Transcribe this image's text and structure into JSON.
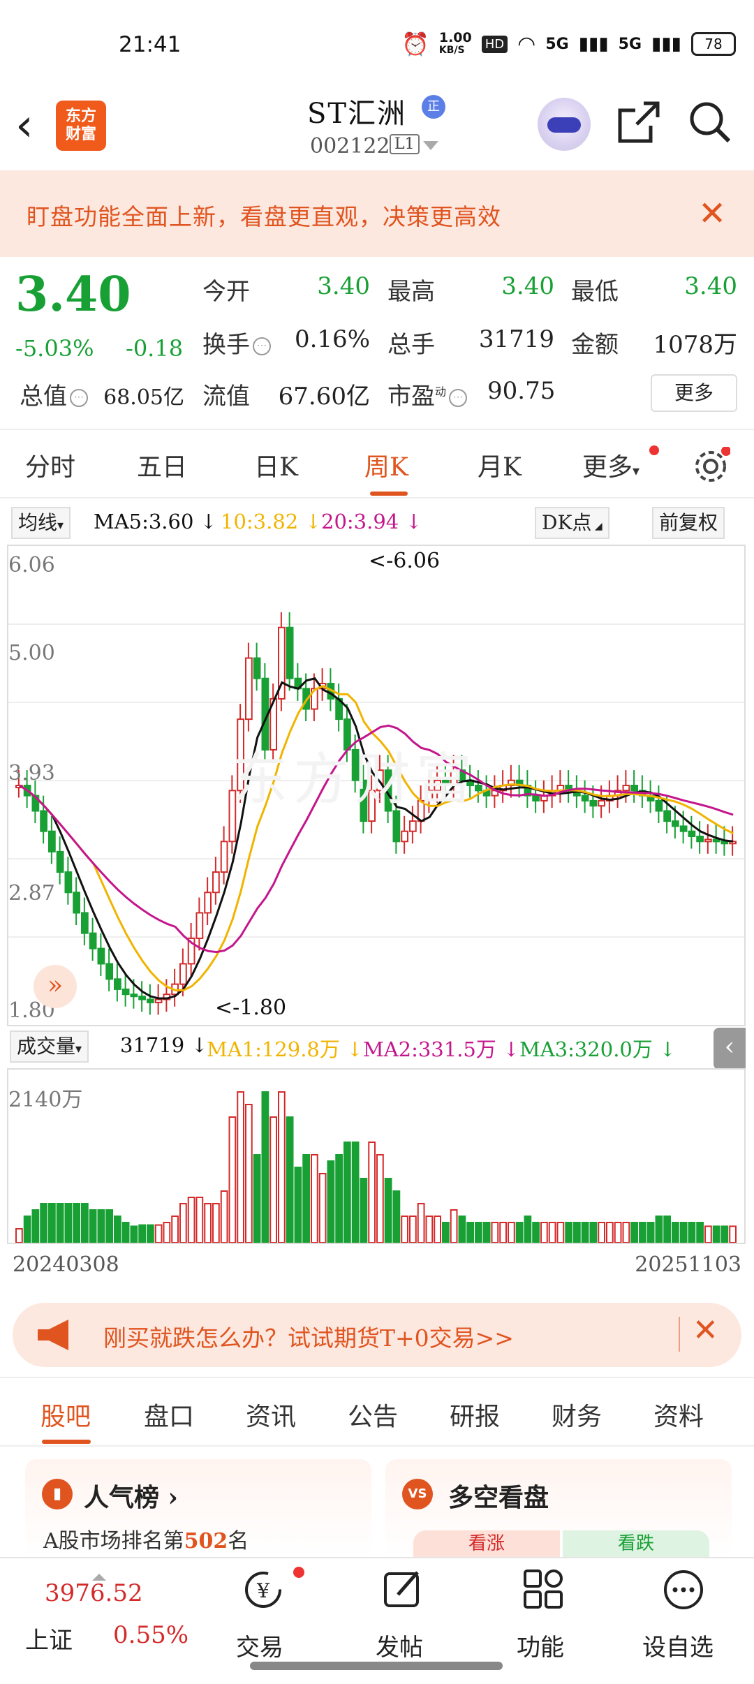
{
  "status_bar": {
    "time": "21:41",
    "net_speed_top": "1.00",
    "net_speed_unit": "KB/S",
    "hd": "HD",
    "sig1": "5G",
    "sig2": "5G",
    "battery": "78"
  },
  "header": {
    "logo_line1": "东方",
    "logo_line2": "财富",
    "title": "ST汇洲",
    "title_badge": "正",
    "code": "002122",
    "level": "L1"
  },
  "notice": {
    "text": "盯盘功能全面上新，看盘更直观，决策更高效"
  },
  "quote": {
    "price": "3.40",
    "change_pct": "-5.03%",
    "change_amt": "-0.18",
    "open_label": "今开",
    "open": "3.40",
    "high_label": "最高",
    "high": "3.40",
    "low_label": "最低",
    "low": "3.40",
    "turnover_label": "换手",
    "turnover": "0.16%",
    "volume_label": "总手",
    "volume": "31719",
    "amount_label": "金额",
    "amount": "1078万",
    "mktcap_label": "总值",
    "mktcap": "68.05亿",
    "float_label": "流值",
    "float": "67.60亿",
    "pe_label": "市盈",
    "pe_sup": "动",
    "pe": "90.75",
    "more": "更多"
  },
  "tabs": [
    "分时",
    "五日",
    "日K",
    "周K",
    "月K",
    "更多"
  ],
  "active_tab": "周K",
  "chart_toolbar": {
    "ma_label": "均线",
    "ma5": "MA5:3.60",
    "ma10": "10:3.82",
    "ma20": "20:3.94",
    "dk": "DK点",
    "adjust": "前复权"
  },
  "kline": {
    "y_ticks": [
      "6.06",
      "5.00",
      "3.93",
      "2.87",
      "1.80"
    ],
    "max_label": "<-6.06",
    "min_label": "<-1.80",
    "watermark": "东方财富"
  },
  "volume_bar": {
    "label": "成交量",
    "vol": "31719",
    "ma1": "MA1:129.8万",
    "ma2": "MA2:331.5万",
    "ma3": "MA3:320.0万",
    "y_tick": "2140万"
  },
  "dates": {
    "start": "20240308",
    "end": "20251103"
  },
  "promo": {
    "text": "刚买就跌怎么办？试试期货T+0交易>>"
  },
  "bottom_tabs": [
    "股吧",
    "盘口",
    "资讯",
    "公告",
    "研报",
    "财务",
    "资料"
  ],
  "cards": {
    "left_title": "人气榜",
    "left_sub_prefix": "A股市场排名第",
    "left_rank": "502",
    "left_sub_suffix": "名",
    "right_title": "多空看盘",
    "bull": "看涨",
    "bear": "看跌"
  },
  "nav": {
    "index_value": "3976.52",
    "index_name": "上证",
    "index_pct": "0.55%",
    "trade": "交易",
    "post": "发帖",
    "func": "功能",
    "watch": "设自选"
  },
  "colors": {
    "accent": "#e0541f",
    "up": "#d42a2a",
    "down": "#18a035",
    "ma5": "#111111",
    "ma10": "#f0b400",
    "ma20": "#c4168c"
  }
}
